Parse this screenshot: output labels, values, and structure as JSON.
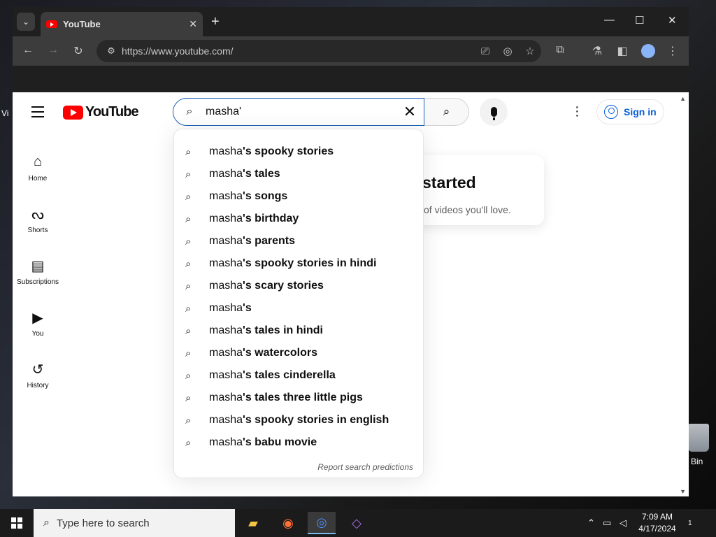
{
  "browser": {
    "tab_title": "YouTube",
    "tab_close": "✕",
    "new_tab": "+",
    "url": "https://www.youtube.com/",
    "controls": {
      "minimize": "—",
      "maximize": "☐",
      "close": "✕"
    }
  },
  "youtube": {
    "logo_text": "YouTube",
    "search_value": "masha'",
    "sign_in_label": "Sign in",
    "guide": [
      {
        "label": "Home",
        "icon": "home-icon",
        "glyph": "⌂"
      },
      {
        "label": "Shorts",
        "icon": "shorts-icon",
        "glyph": "ᔓ"
      },
      {
        "label": "Subscriptions",
        "icon": "subscriptions-icon",
        "glyph": "▤"
      },
      {
        "label": "You",
        "icon": "you-icon",
        "glyph": "▶"
      },
      {
        "label": "History",
        "icon": "history-icon",
        "glyph": "↺"
      }
    ],
    "card": {
      "heading": "started",
      "subtext": "of videos you'll love."
    },
    "suggestions": [
      {
        "prefix": "masha",
        "rest": "'s spooky stories"
      },
      {
        "prefix": "masha",
        "rest": "'s tales"
      },
      {
        "prefix": "masha",
        "rest": "'s songs"
      },
      {
        "prefix": "masha",
        "rest": "'s birthday"
      },
      {
        "prefix": "masha",
        "rest": "'s parents"
      },
      {
        "prefix": "masha",
        "rest": "'s spooky stories in hindi"
      },
      {
        "prefix": "masha",
        "rest": "'s scary stories"
      },
      {
        "prefix": "masha",
        "rest": "'s"
      },
      {
        "prefix": "masha",
        "rest": "'s tales in hindi"
      },
      {
        "prefix": "masha",
        "rest": "'s watercolors"
      },
      {
        "prefix": "masha",
        "rest": "'s tales cinderella"
      },
      {
        "prefix": "masha",
        "rest": "'s tales three little pigs"
      },
      {
        "prefix": "masha",
        "rest": "'s spooky stories in english"
      },
      {
        "prefix": "masha",
        "rest": "'s babu movie"
      }
    ],
    "report_label": "Report search predictions"
  },
  "taskbar": {
    "search_placeholder": "Type here to search",
    "time": "7:09 AM",
    "date": "4/17/2024",
    "notification_count": "1"
  },
  "desktop": {
    "bin_label": "Bin"
  },
  "colors": {
    "accent": "#065fd4",
    "youtube_red": "#ff0000",
    "search_border": "#1c62b9"
  }
}
